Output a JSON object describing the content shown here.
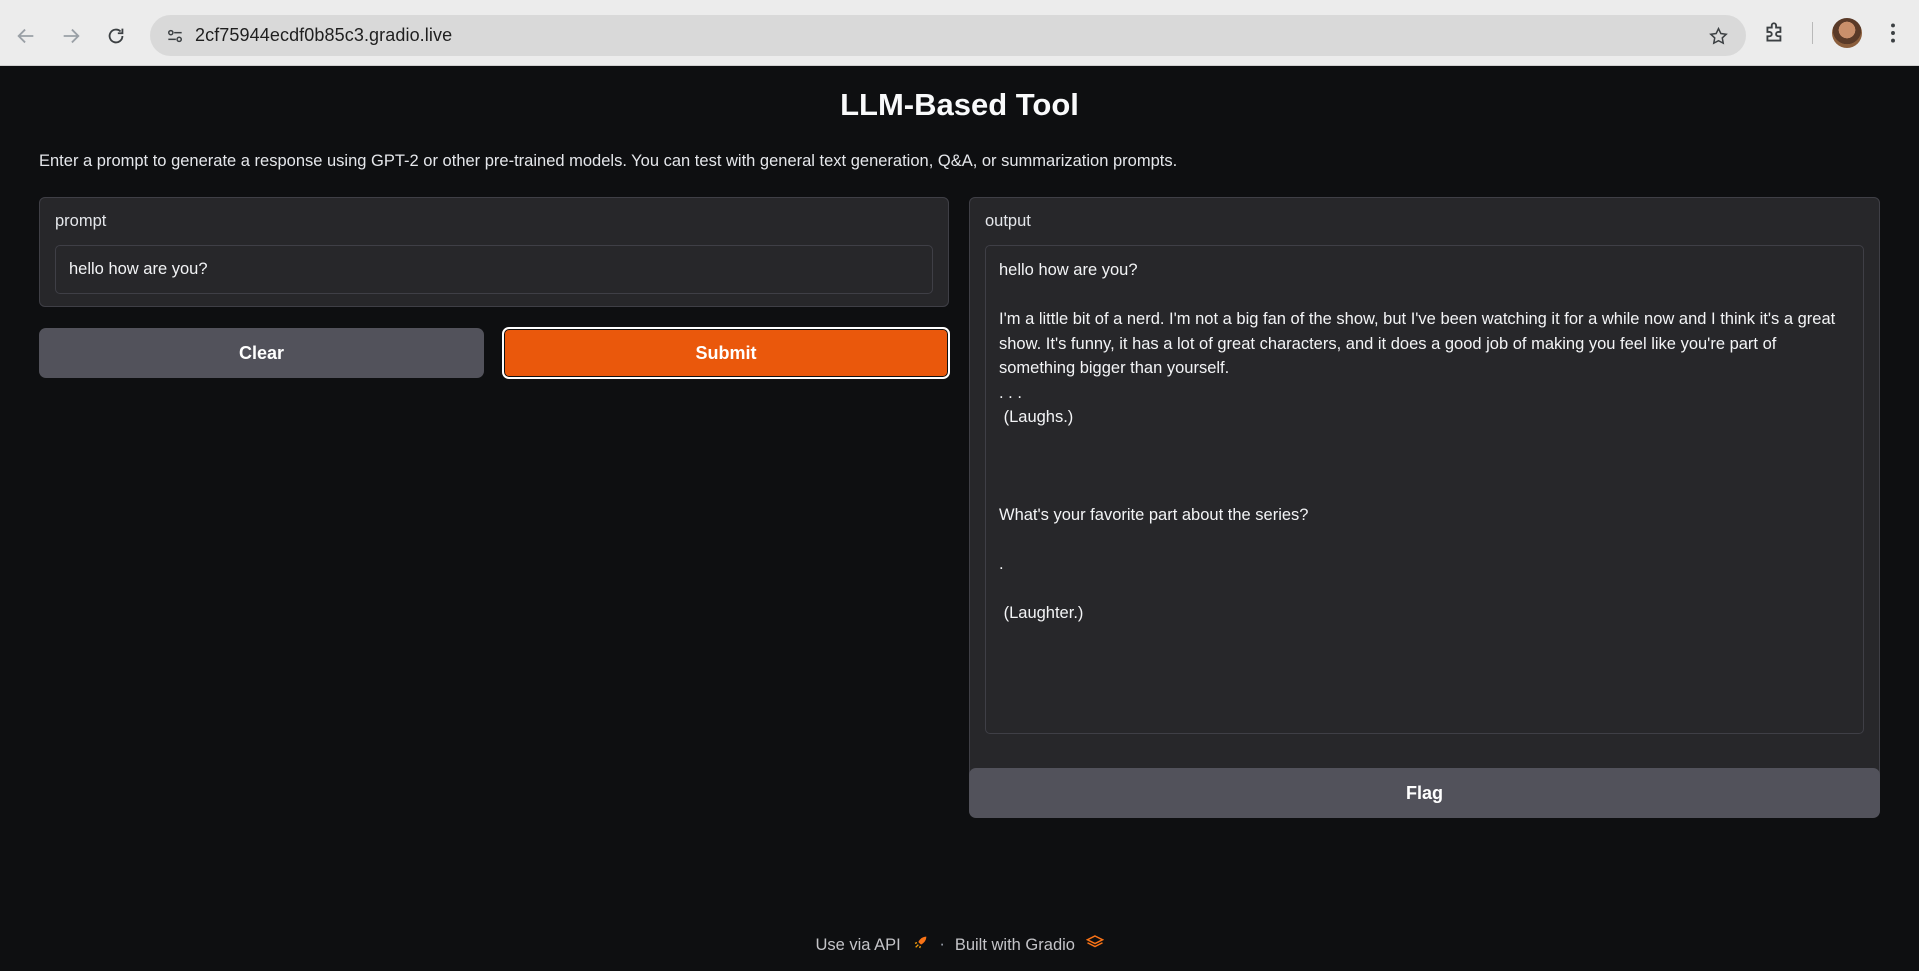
{
  "browser": {
    "url": "2cf75944ecdf0b85c3.gradio.live",
    "icons": [
      "back-arrow-icon",
      "forward-arrow-icon",
      "reload-icon",
      "site-info-icon",
      "star-icon",
      "extensions-icon",
      "profile-avatar",
      "menu-kebab-icon"
    ]
  },
  "app": {
    "title": "LLM-Based Tool",
    "description": "Enter a prompt to generate a response using GPT-2 or other pre-trained models. You can test with general text generation, Q&A, or summarization prompts."
  },
  "input_panel": {
    "label": "prompt",
    "value": "hello how are you?"
  },
  "buttons": {
    "clear_label": "Clear",
    "submit_label": "Submit",
    "flag_label": "Flag"
  },
  "output_panel": {
    "label": "output",
    "value": "hello how are you?\n\nI'm a little bit of a nerd. I'm not a big fan of the show, but I've been watching it for a while now and I think it's a great show. It's funny, it has a lot of great characters, and it does a good job of making you feel like you're part of something bigger than yourself.\n. . .\n (Laughs.)\n\n\n\nWhat's your favorite part about the series?\n\n.\n\n (Laughter.)"
  },
  "footer": {
    "api_label": "Use via API",
    "separator": "·",
    "built_label": "Built with Gradio"
  },
  "colors": {
    "primary": "#ea580c",
    "secondary": "#52525b",
    "background": "#0e0f11",
    "panel": "#27272a"
  }
}
